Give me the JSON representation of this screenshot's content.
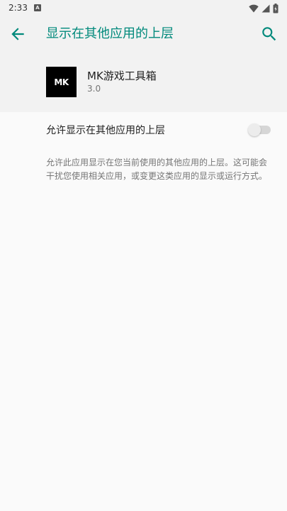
{
  "status_bar": {
    "time": "2:33",
    "notification_icon": "a-icon",
    "icons": [
      "wifi-icon",
      "signal-icon",
      "battery-icon"
    ]
  },
  "app_bar": {
    "title": "显示在其他应用的上层",
    "back_icon": "arrow-back-icon",
    "search_icon": "search-icon"
  },
  "app_info": {
    "icon_text": "MK",
    "name": "MK游戏工具箱",
    "version": "3.0"
  },
  "permission": {
    "label": "允许显示在其他应用的上层",
    "enabled": false
  },
  "description": "允许此应用显示在您当前使用的其他应用的上层。这可能会干扰您使用相关应用，或变更这类应用的显示或运行方式。",
  "colors": {
    "accent": "#00897b",
    "background": "#fafafa",
    "header_background": "#f2f2f2"
  }
}
